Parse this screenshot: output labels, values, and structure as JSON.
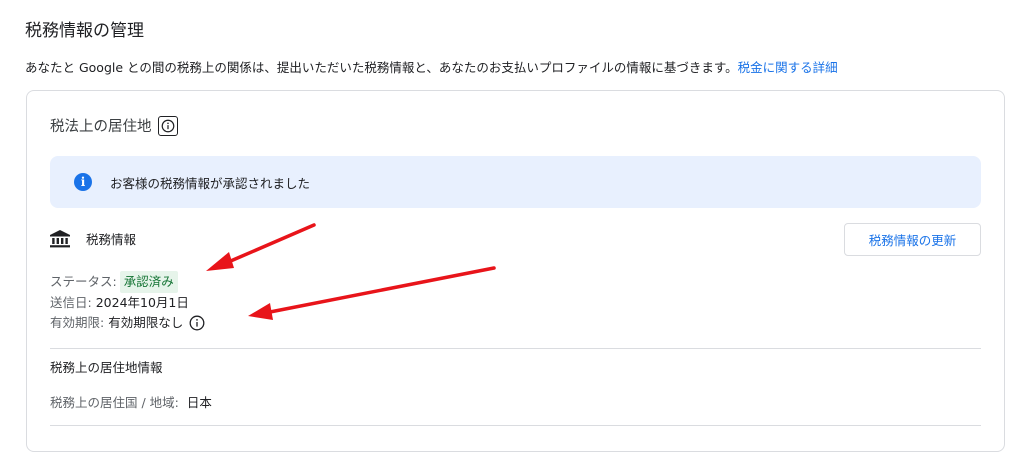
{
  "header": {
    "title": "税務情報の管理",
    "description": "あなたと Google との間の税務上の関係は、提出いただいた税務情報と、あなたのお支払いプロファイルの情報に基づきます。",
    "details_link": "税金に関する詳細"
  },
  "residence_section": {
    "title": "税法上の居住地",
    "info_icon": "info-icon"
  },
  "banner": {
    "icon": "info-filled-icon",
    "text": "お客様の税務情報が承認されました",
    "color": "#e8f0fe",
    "icon_color": "#1a73e8"
  },
  "tax_info": {
    "icon": "bank-icon",
    "label": "税務情報",
    "update_button": "税務情報の更新",
    "status_label": "ステータス:",
    "status_value": "承認済み",
    "status_color": "#137333",
    "status_bg": "#e6f4ea",
    "sent_label": "送信日:",
    "sent_value": "2024年10月1日",
    "expiry_label": "有効期限:",
    "expiry_value": "有効期限なし"
  },
  "residence_info": {
    "title": "税務上の居住地情報",
    "country_label": "税務上の居住国 / 地域:",
    "country_value": "日本"
  },
  "annotations": {
    "arrow_color": "#e8141a"
  }
}
